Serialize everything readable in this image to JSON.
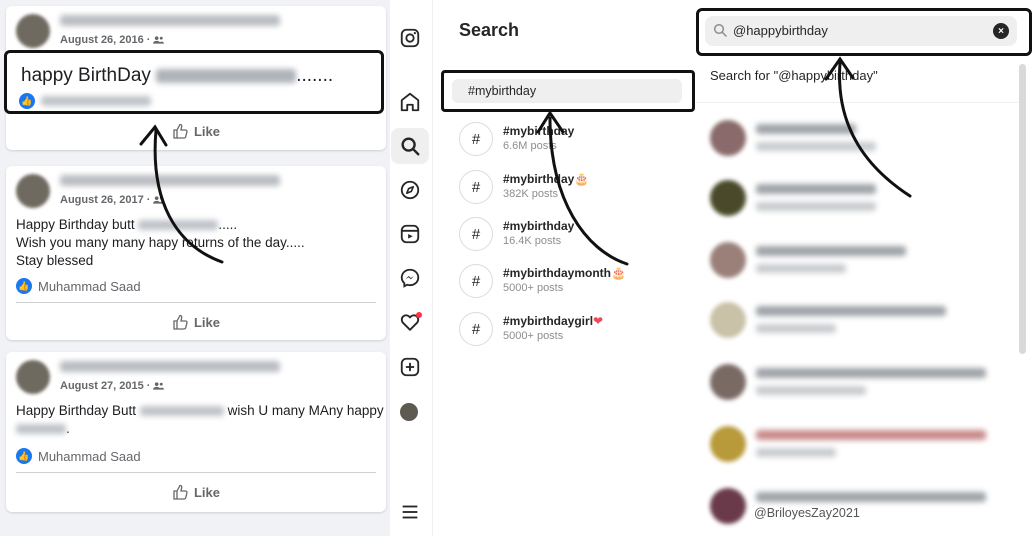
{
  "facebook": {
    "posts": [
      {
        "date": "August 26, 2016",
        "highlight_text": "happy BirthDay",
        "highlight_suffix": ".......",
        "like_label": "Like"
      },
      {
        "date": "August 26, 2017",
        "line1_a": "Happy Birthday butt",
        "line1_b": ".....",
        "line2": "Wish you many many hapy returns of the day.....",
        "line3": "Stay blessed",
        "reactor": "Muhammad Saad",
        "like_label": "Like"
      },
      {
        "date": "August 27, 2015",
        "line1_a": "Happy Birthday Butt",
        "line1_b": "wish U many MAny happy",
        "line2_suffix": ".",
        "reactor": "Muhammad Saad",
        "like_label": "Like"
      }
    ],
    "date_sep": "·"
  },
  "sidebar": {
    "icons": [
      "instagram-icon",
      "home-icon",
      "search-icon",
      "explore-icon",
      "reels-icon",
      "messenger-icon",
      "notifications-icon",
      "create-icon",
      "profile-avatar",
      "menu-icon"
    ]
  },
  "search_panel": {
    "title": "Search",
    "highlighted_tag": "#mybirthday",
    "tags": [
      {
        "name": "#mybirthday",
        "emoji": "",
        "count": "6.6M posts"
      },
      {
        "name": "#mybirthday",
        "emoji": "🎂",
        "count": "382K posts"
      },
      {
        "name": "#mybirthday",
        "emoji": "",
        "count": "16.4K posts"
      },
      {
        "name": "#mybirthdaymonth",
        "emoji": "🎂",
        "count": "5000+ posts"
      },
      {
        "name": "#mybirthdaygirl",
        "emoji": "❤",
        "count": "5000+ posts"
      }
    ],
    "hash_symbol": "#"
  },
  "dropdown": {
    "search_value": "@happybirthday",
    "clear_symbol": "×",
    "search_for": "Search for \"@happybirthday\"",
    "last_handle": "@BriloyesZay2021",
    "colors": {
      "accent": "#1877f2",
      "notification": "#ff3040"
    }
  }
}
